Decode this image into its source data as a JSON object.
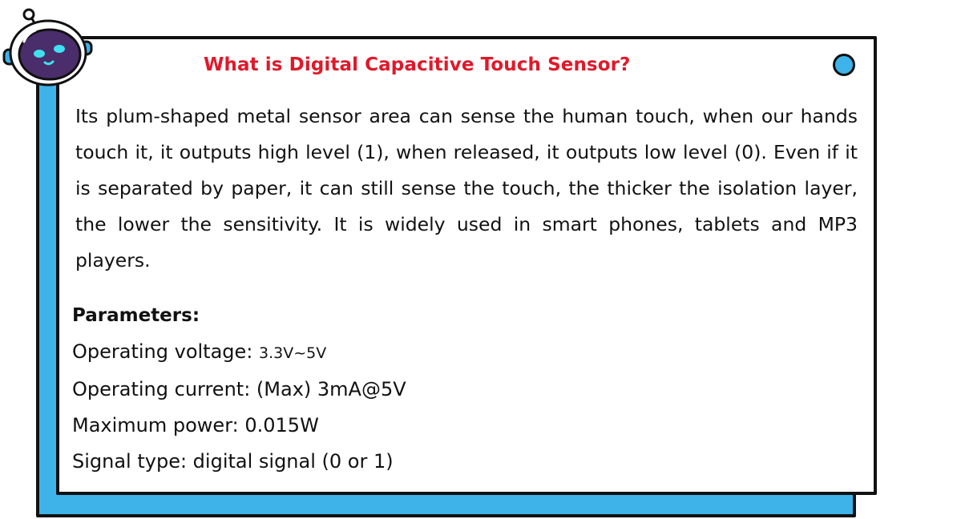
{
  "card": {
    "title": "What is Digital Capacitive Touch Sensor?",
    "description": "Its plum-shaped metal sensor area can sense the human touch, when our hands touch it, it outputs high level (1), when released, it outputs low level (0). Even if it is separated by paper, it can still sense the touch, the thicker the isolation layer, the lower the sensitivity. It is widely used in smart phones, tablets and MP3 players."
  },
  "parameters": {
    "heading": "Parameters:",
    "voltage_label": "Operating voltage: ",
    "voltage_value": "3.3V~5V",
    "current": "Operating current: (Max) 3mA@5V",
    "power": "Maximum power: 0.015W",
    "signal": "Signal type: digital signal (0 or 1)"
  },
  "colors": {
    "accent_blue": "#3db3ea",
    "title_red": "#e0192a",
    "border": "#111111",
    "mascot_purple": "#4a2d6b"
  },
  "icons": {
    "mascot": "robot-mascot-icon",
    "corner": "blue-dot-icon"
  }
}
